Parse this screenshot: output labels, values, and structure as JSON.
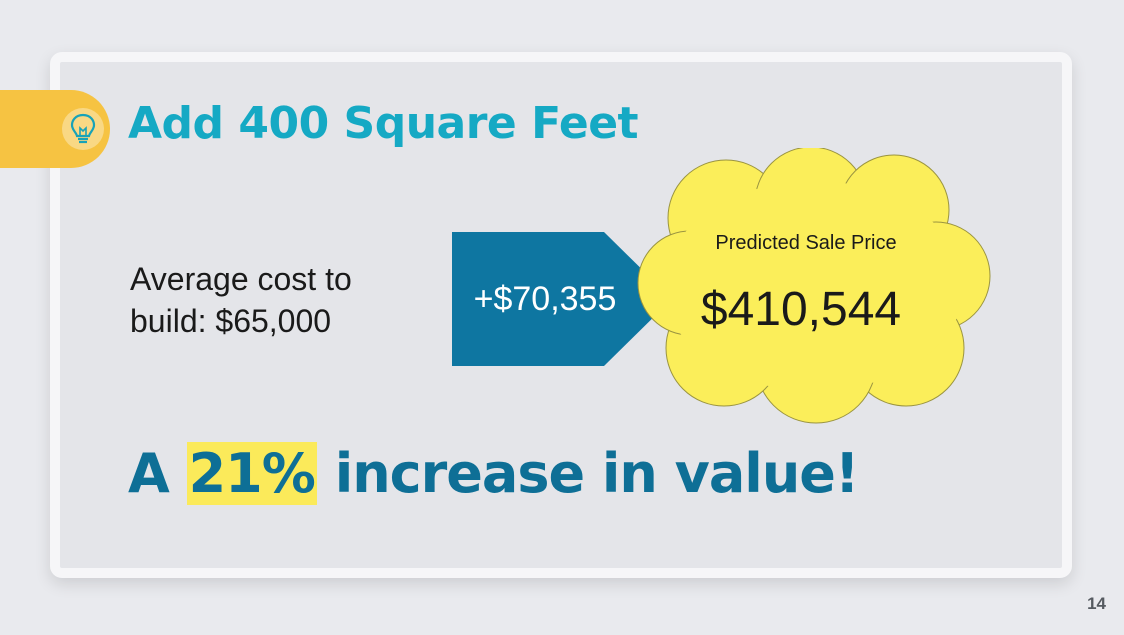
{
  "slide": {
    "title": "Add 400 Square Feet",
    "cost_text": "Average cost to build: $65,000",
    "increase_amount": "+$70,355",
    "prediction_label": "Predicted Sale Price",
    "predicted_price": "$410,544",
    "headline_prefix": "A",
    "headline_highlight": "21%",
    "headline_suffix": "increase in value!",
    "page_number": "14"
  },
  "colors": {
    "title": "#15a9c4",
    "headline": "#0e6f96",
    "arrow": "#0e76a1",
    "cloud": "#fbee5a",
    "highlight": "#fbea5a",
    "tag": "#f6c342"
  },
  "icons": {
    "tag_icon": "lightbulb-icon"
  }
}
